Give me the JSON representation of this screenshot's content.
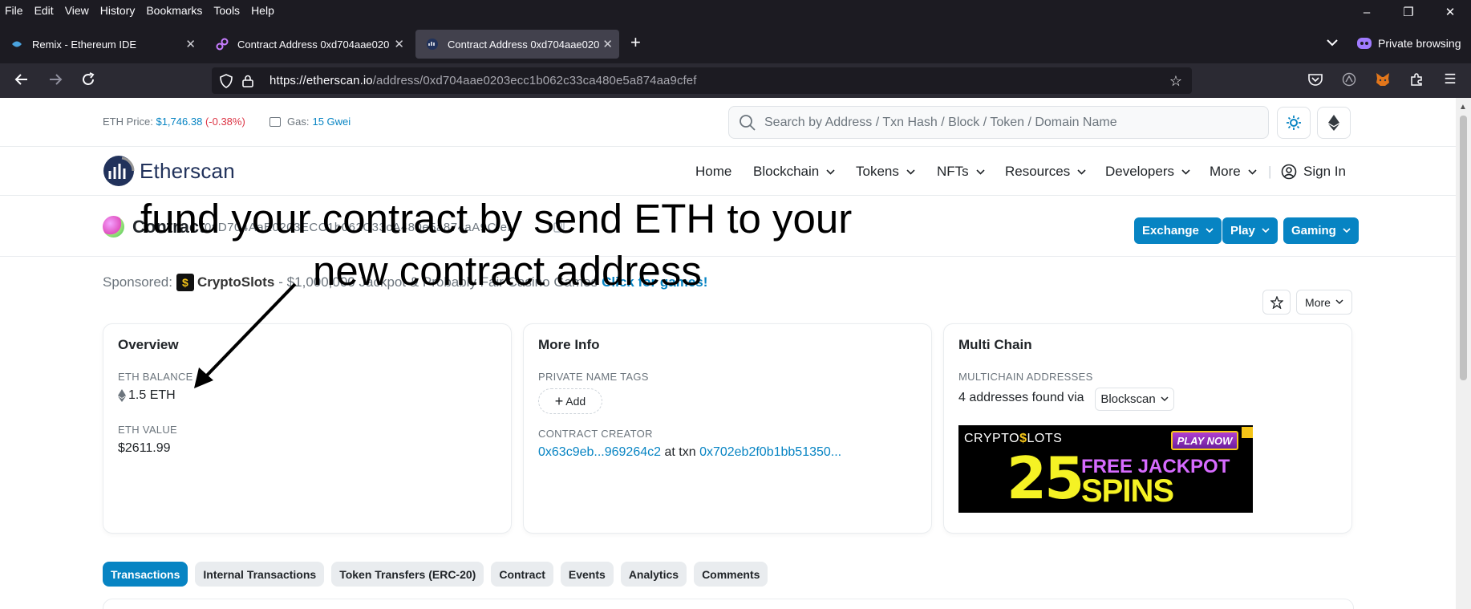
{
  "menubar": {
    "items": [
      {
        "label": "File"
      },
      {
        "label": "Edit"
      },
      {
        "label": "View"
      },
      {
        "label": "History"
      },
      {
        "label": "Bookmarks"
      },
      {
        "label": "Tools"
      },
      {
        "label": "Help"
      }
    ]
  },
  "tabs": [
    {
      "label": "Remix - Ethereum IDE",
      "icon": "remix-icon"
    },
    {
      "label": "Contract Address 0xd704aae020",
      "icon": "link-icon"
    },
    {
      "label": "Contract Address 0xd704aae020",
      "icon": "etherscan-icon"
    }
  ],
  "browser": {
    "private_label": "Private browsing",
    "url_host": "https://etherscan.io",
    "url_path": "/address/0xd704aae0203ecc1b062c33ca480e5a874aa9cfef"
  },
  "topstrip": {
    "price_label": "ETH Price:",
    "price_value": "$1,746.38",
    "price_change": "(-0.38%)",
    "gas_label": "Gas:",
    "gas_value": "15 Gwei",
    "search_placeholder": "Search by Address / Txn Hash / Block / Token / Domain Name"
  },
  "nav": {
    "logo_text": "Etherscan",
    "items": [
      {
        "label": "Home"
      },
      {
        "label": "Blockchain"
      },
      {
        "label": "Tokens"
      },
      {
        "label": "NFTs"
      },
      {
        "label": "Resources"
      },
      {
        "label": "Developers"
      },
      {
        "label": "More"
      }
    ],
    "separator": "|",
    "signin": "Sign In"
  },
  "contract": {
    "title": "Contract",
    "address": "0xD704AaE0203ECC1b062C33cA480e5a874aA9Cfef",
    "buttons": [
      {
        "label": "Exchange"
      },
      {
        "label": "Play"
      },
      {
        "label": "Gaming"
      }
    ]
  },
  "sponsored": {
    "label": "Sponsored:",
    "logo_glyph": "$",
    "brand": "CryptoSlots",
    "text": "- $1,000,000 Jackpot & Probably Fair Casino Games",
    "cta": "Click for games!"
  },
  "actions": {
    "more_label": "More"
  },
  "overview": {
    "title": "Overview",
    "eth_balance_label": "ETH BALANCE",
    "eth_balance": "1.5 ETH",
    "eth_value_label": "ETH VALUE",
    "eth_value": "$2611.99"
  },
  "more_info": {
    "title": "More Info",
    "private_tags_label": "PRIVATE NAME TAGS",
    "add_label": "Add",
    "creator_label": "CONTRACT CREATOR",
    "creator_addr": "0x63c9eb...969264c2",
    "at_txn": "at txn",
    "txn_hash": "0x702eb2f0b1bb51350..."
  },
  "multichain": {
    "title": "Multi Chain",
    "label": "MULTICHAIN ADDRESSES",
    "found_text": "4 addresses found via",
    "dropdown": "Blockscan",
    "ad": {
      "brand_a": "CRYPTO",
      "brand_b": "$",
      "brand_c": "LOTS",
      "play": "PLAY NOW",
      "big": "25",
      "line1": "FREE JACKPOT",
      "line2": "SPINS"
    }
  },
  "content_tabs": [
    {
      "label": "Transactions",
      "active": true
    },
    {
      "label": "Internal Transactions"
    },
    {
      "label": "Token Transfers (ERC-20)"
    },
    {
      "label": "Contract"
    },
    {
      "label": "Events"
    },
    {
      "label": "Analytics"
    },
    {
      "label": "Comments"
    }
  ],
  "annotation": {
    "line1": "fund your contract by send ETH to your",
    "line2": "new contract  address"
  },
  "colors": {
    "accent": "#0784c3",
    "negative": "#dc3545",
    "chrome_dark": "#1c1b22"
  }
}
